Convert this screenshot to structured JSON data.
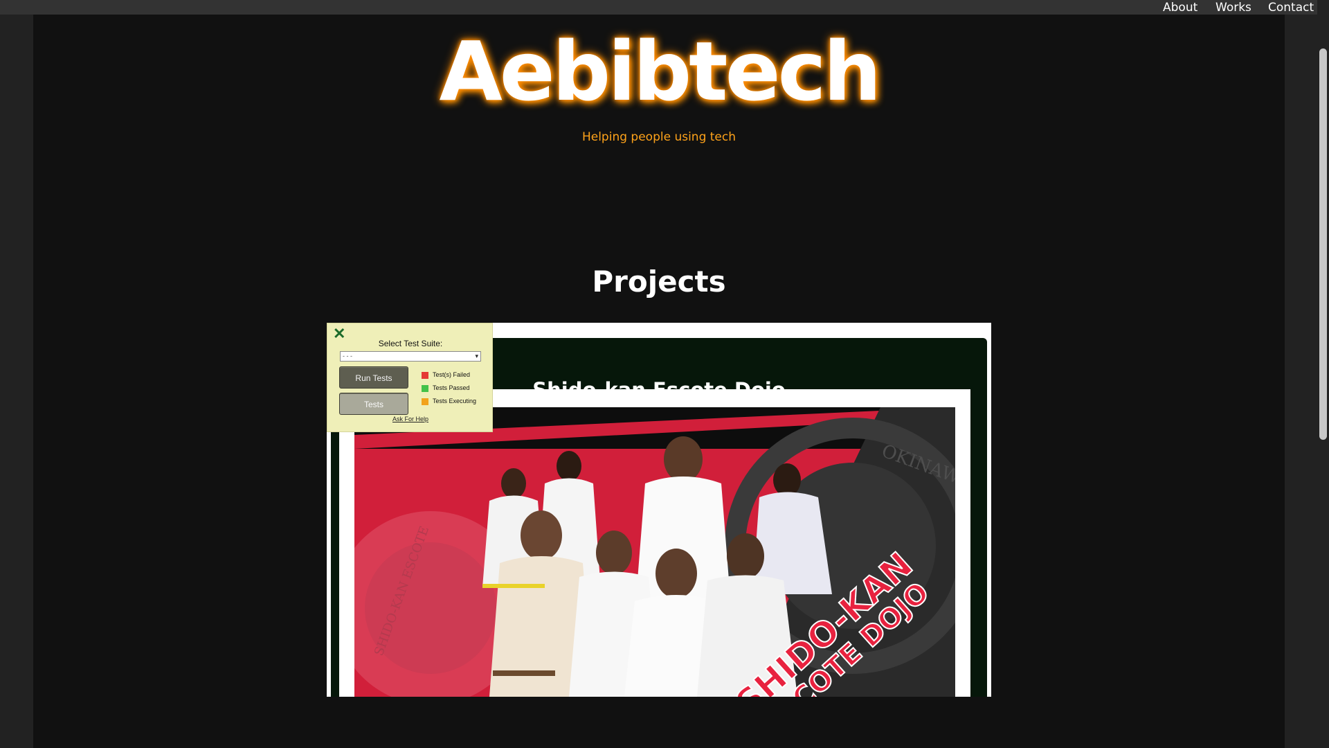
{
  "nav": {
    "about": "About",
    "works": "Works",
    "contact": "Contact"
  },
  "hero": {
    "title": "Aebibtech",
    "tagline": "Helping people using tech"
  },
  "projects": {
    "heading": "Projects",
    "items": [
      {
        "title": "Shido-kan Escote Dojo",
        "banner_text": "SHIDO-KAN\nESCOTE DOJO",
        "seal_text": "OKINAWA SHORIN-RYU KARATE-DO",
        "seal_text_left": "SHIDO-KAN ESCOTE"
      }
    ]
  },
  "test_panel": {
    "select_label": "Select Test Suite:",
    "select_value": "- - -",
    "run_button": "Run Tests",
    "tests_button": "Tests",
    "legend": [
      {
        "label": "Test(s) Failed",
        "color": "#e53935"
      },
      {
        "label": "Tests Passed",
        "color": "#43c24a"
      },
      {
        "label": "Tests Executing",
        "color": "#f2a31b"
      }
    ],
    "help_link": "Ask For Help"
  },
  "colors": {
    "accent": "#ffa31a",
    "glow": "#ff8a00",
    "page_bg": "#111111"
  }
}
